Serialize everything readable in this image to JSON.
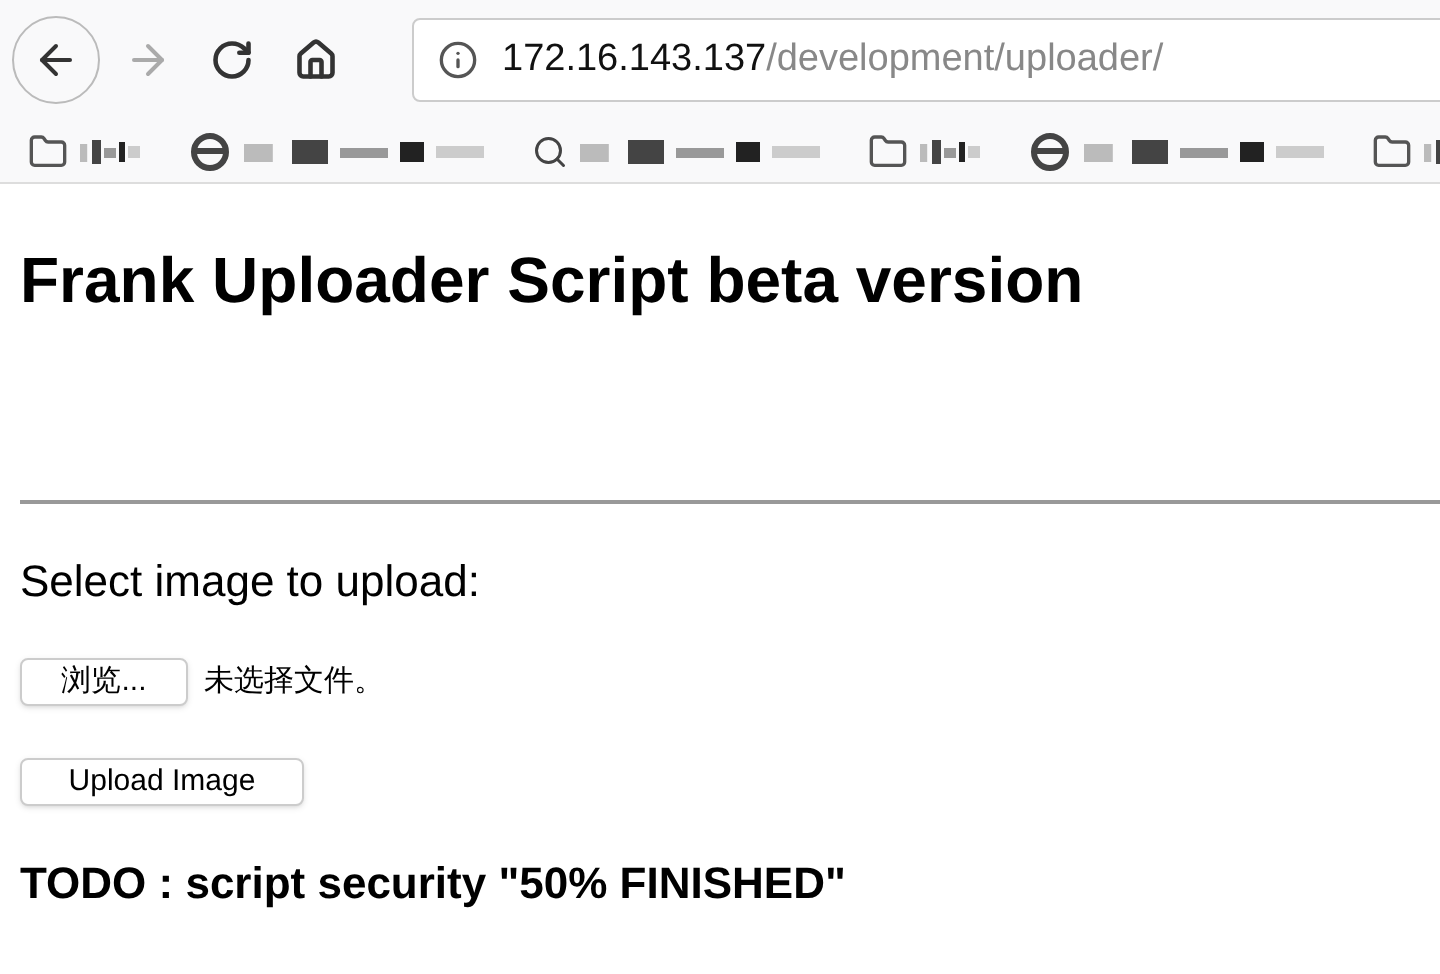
{
  "address_bar": {
    "host": "172.16.143.137",
    "path": "/development/uploader/"
  },
  "bookmarks": [
    {
      "kind": "folder"
    },
    {
      "kind": "web"
    },
    {
      "kind": "search"
    },
    {
      "kind": "folder"
    },
    {
      "kind": "web"
    },
    {
      "kind": "folder"
    }
  ],
  "heading": "Frank Uploader Script beta version",
  "prompt": "Select image to upload:",
  "file_input": {
    "button": "浏览...",
    "status": "未选择文件。"
  },
  "submit_button": "Upload Image",
  "todo": "TODO : script security \"50% FINISHED\""
}
